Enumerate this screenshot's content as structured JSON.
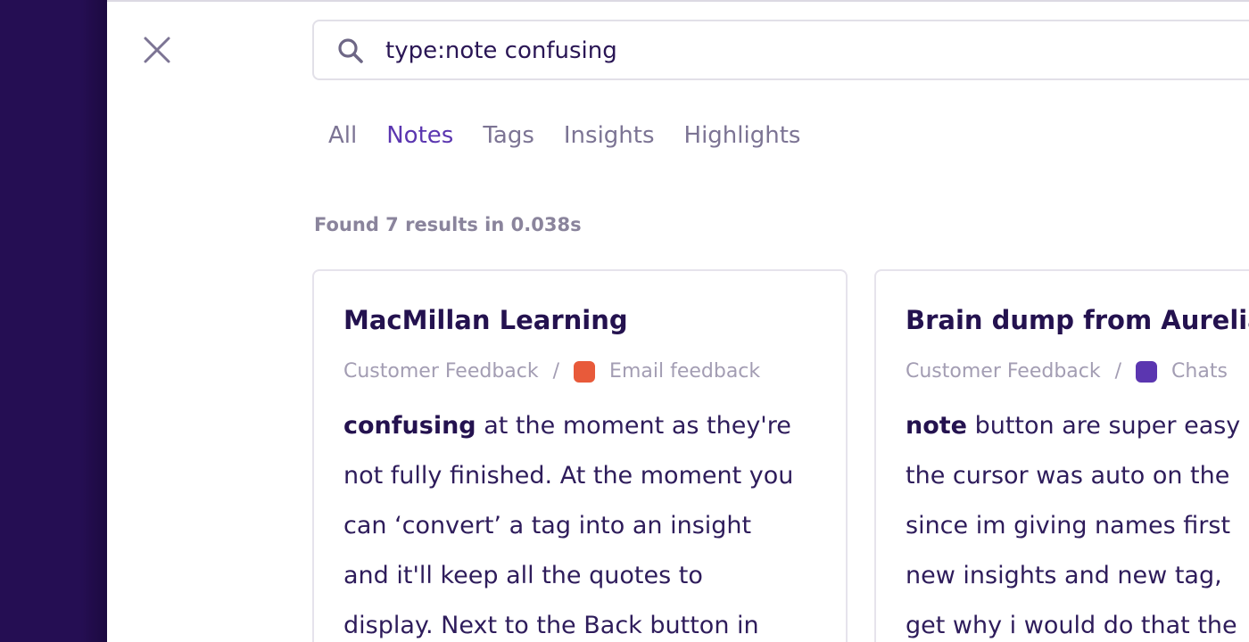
{
  "search": {
    "query": "type:note confusing"
  },
  "tabs": [
    {
      "label": "All"
    },
    {
      "label": "Notes"
    },
    {
      "label": "Tags"
    },
    {
      "label": "Insights"
    },
    {
      "label": "Highlights"
    }
  ],
  "active_tab": "Notes",
  "results_summary": "Found 7 results in 0.038s",
  "colors": {
    "sidebar": "#250e53",
    "accent": "#5b36b0",
    "tag_email": "#e85a3a",
    "tag_chats": "#5b36b0"
  },
  "icons": {
    "close": "close-icon",
    "search": "search-icon"
  },
  "results": [
    {
      "title": "MacMillan Learning",
      "breadcrumb_parent": "Customer Feedback",
      "separator": "/",
      "tag_label": "Email feedback",
      "snippet_highlight": "confusing",
      "snippet_lines": [
        " at the moment as they're",
        "not fully finished. At the moment you",
        "can ‘convert’ a tag into an insight",
        "and it'll keep all the quotes to",
        "display. Next to the Back button in"
      ]
    },
    {
      "title": "Brain dump from Aurelia",
      "breadcrumb_parent": "Customer Feedback",
      "separator": "/",
      "tag_label": "Chats",
      "snippet_highlight": "note",
      "snippet_lines": [
        " button are super easy",
        "the cursor was auto on the",
        "since im giving names first",
        "new insights and new tag,",
        "get why i would do that the"
      ]
    }
  ]
}
